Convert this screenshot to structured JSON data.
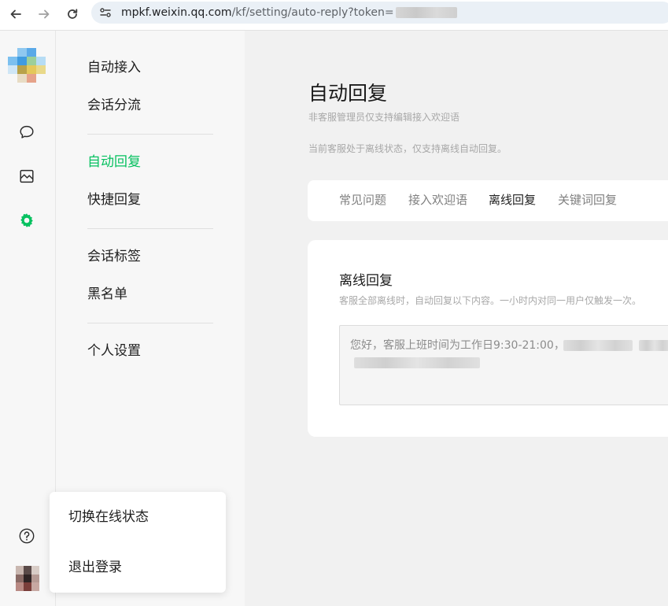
{
  "browser": {
    "url_host": "mpkf.weixin.qq.com",
    "url_path": "/kf/setting/auto-reply?token="
  },
  "rail": {
    "icons": [
      "chat-icon",
      "image-icon",
      "gear-icon",
      "help-icon"
    ],
    "active_color": "#07c160"
  },
  "subnav": {
    "items": [
      {
        "label": "自动接入"
      },
      {
        "label": "会话分流"
      },
      {
        "label": "自动回复",
        "active": true
      },
      {
        "label": "快捷回复"
      },
      {
        "label": "会话标签"
      },
      {
        "label": "黑名单"
      },
      {
        "label": "个人设置"
      }
    ]
  },
  "main": {
    "title": "自动回复",
    "subtitle": "非客服管理员仅支持编辑接入欢迎语",
    "notice": "当前客服处于离线状态，仅支持离线自动回复。",
    "tabs": [
      {
        "label": "常见问题"
      },
      {
        "label": "接入欢迎语"
      },
      {
        "label": "离线回复",
        "active": true
      },
      {
        "label": "关键词回复"
      }
    ],
    "section": {
      "title": "离线回复",
      "description": "客服全部离线时，自动回复以下内容。一小时内对同一用户仅触发一次。",
      "reply_text": "您好，客服上班时间为工作日9:30-21:00，"
    }
  },
  "popup": {
    "items": [
      {
        "label": "切换在线状态"
      },
      {
        "label": "退出登录"
      }
    ]
  }
}
